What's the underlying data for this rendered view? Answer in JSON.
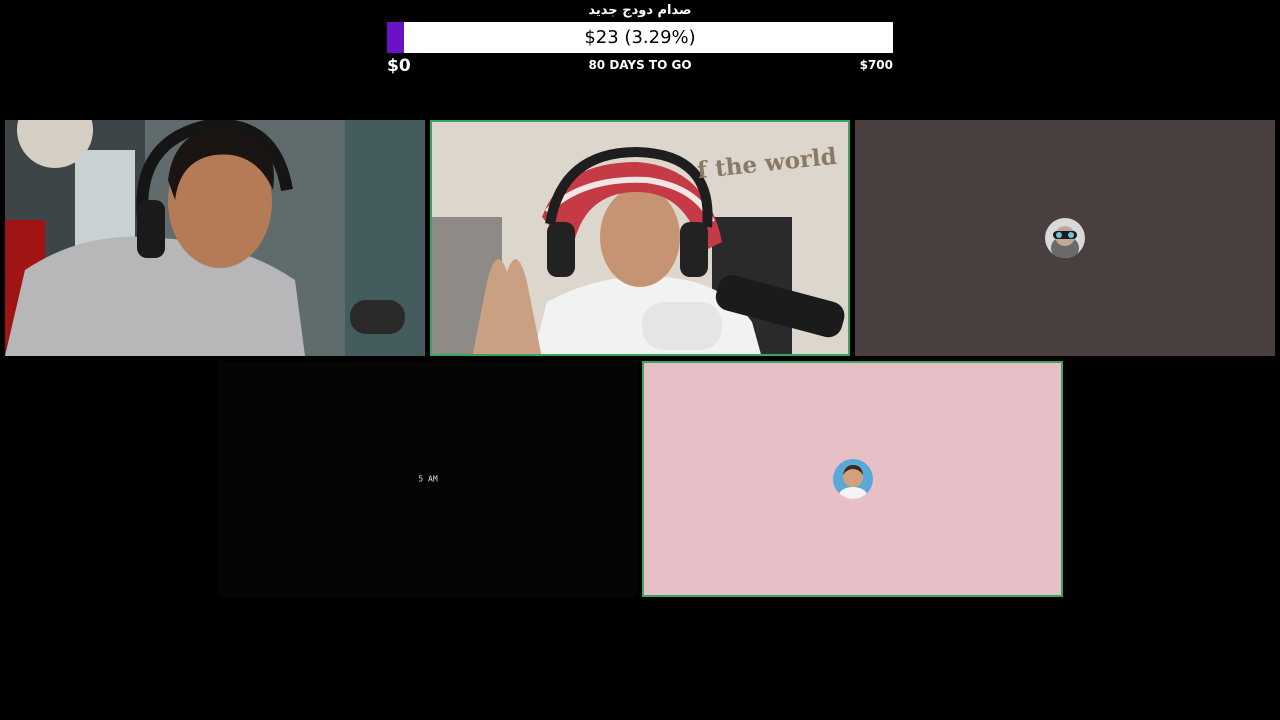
{
  "goal": {
    "title": "صدام دودج جديد",
    "amount_text": "$23 (3.29%)",
    "progress_fraction": 0.0329,
    "min_label": "$0",
    "days_label": "80 DAYS TO GO",
    "max_label": "$700",
    "fill_color": "#6b12c8"
  },
  "tiles": [
    {
      "id": "participant-1",
      "type": "video"
    },
    {
      "id": "participant-2",
      "type": "video",
      "wall_text": "f the world",
      "active": true
    },
    {
      "id": "participant-3",
      "type": "avatar",
      "avatar_icon": "goggles-avatar-icon",
      "bg": "#4a3f3f"
    },
    {
      "id": "participant-4",
      "type": "blank",
      "caption": "5 AM"
    },
    {
      "id": "participant-5",
      "type": "avatar",
      "avatar_icon": "child-avatar-icon",
      "bg": "#e7bfc7",
      "active": true
    }
  ]
}
